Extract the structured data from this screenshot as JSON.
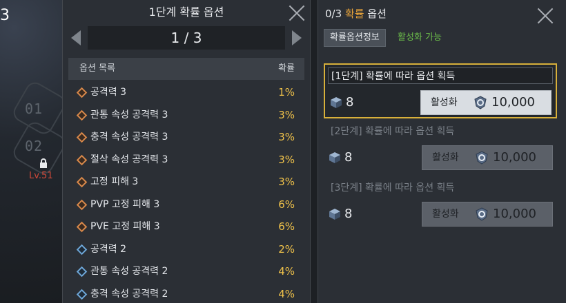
{
  "background": {
    "steps": [
      "01",
      "02"
    ],
    "level_text": "Lv.51",
    "corner_text": "3"
  },
  "prob_panel": {
    "title": "1단계 확률 옵션",
    "page": "1 / 3",
    "col_name": "옵션 목록",
    "col_rate": "확률",
    "options": [
      {
        "name": "공격력 3",
        "rate": "1%",
        "tier": "orange"
      },
      {
        "name": "관통 속성 공격력 3",
        "rate": "3%",
        "tier": "orange"
      },
      {
        "name": "충격 속성 공격력 3",
        "rate": "3%",
        "tier": "orange"
      },
      {
        "name": "절삭 속성 공격력 3",
        "rate": "3%",
        "tier": "orange"
      },
      {
        "name": "고정 피해 3",
        "rate": "3%",
        "tier": "orange"
      },
      {
        "name": "PVP 고정 피해 3",
        "rate": "6%",
        "tier": "orange"
      },
      {
        "name": "PVE 고정 피해 3",
        "rate": "6%",
        "tier": "orange"
      },
      {
        "name": "공격력 2",
        "rate": "2%",
        "tier": "blue"
      },
      {
        "name": "관통 속성 공격력 2",
        "rate": "4%",
        "tier": "blue"
      },
      {
        "name": "충격 속성 공격력 2",
        "rate": "4%",
        "tier": "blue"
      }
    ]
  },
  "act_panel": {
    "title_count": "0/3",
    "title_hl": "확률",
    "title_rest": " 옵션",
    "info_tab": "확률옵션정보",
    "active_note": "활성화 가능",
    "stages": [
      {
        "label": "[1단계] 확률에 따라 옵션 획득",
        "count": "8",
        "button": "활성화",
        "cost": "10,000",
        "selected": true
      },
      {
        "label": "[2단계] 확률에 따라 옵션 획득",
        "count": "8",
        "button": "활성화",
        "cost": "10,000",
        "selected": false
      },
      {
        "label": "[3단계] 확률에 따라 옵션 획득",
        "count": "8",
        "button": "활성화",
        "cost": "10,000",
        "selected": false
      }
    ]
  },
  "colors": {
    "rate_yellow": "#f0c24a",
    "selected_border": "#d8b03a",
    "active_green": "#6dbf4a",
    "title_highlight": "#e7a33a"
  },
  "icons": [
    "close-icon",
    "chevron-left-icon",
    "chevron-right-icon",
    "diamond-icon",
    "cube-icon",
    "coin-icon",
    "lock-icon"
  ]
}
